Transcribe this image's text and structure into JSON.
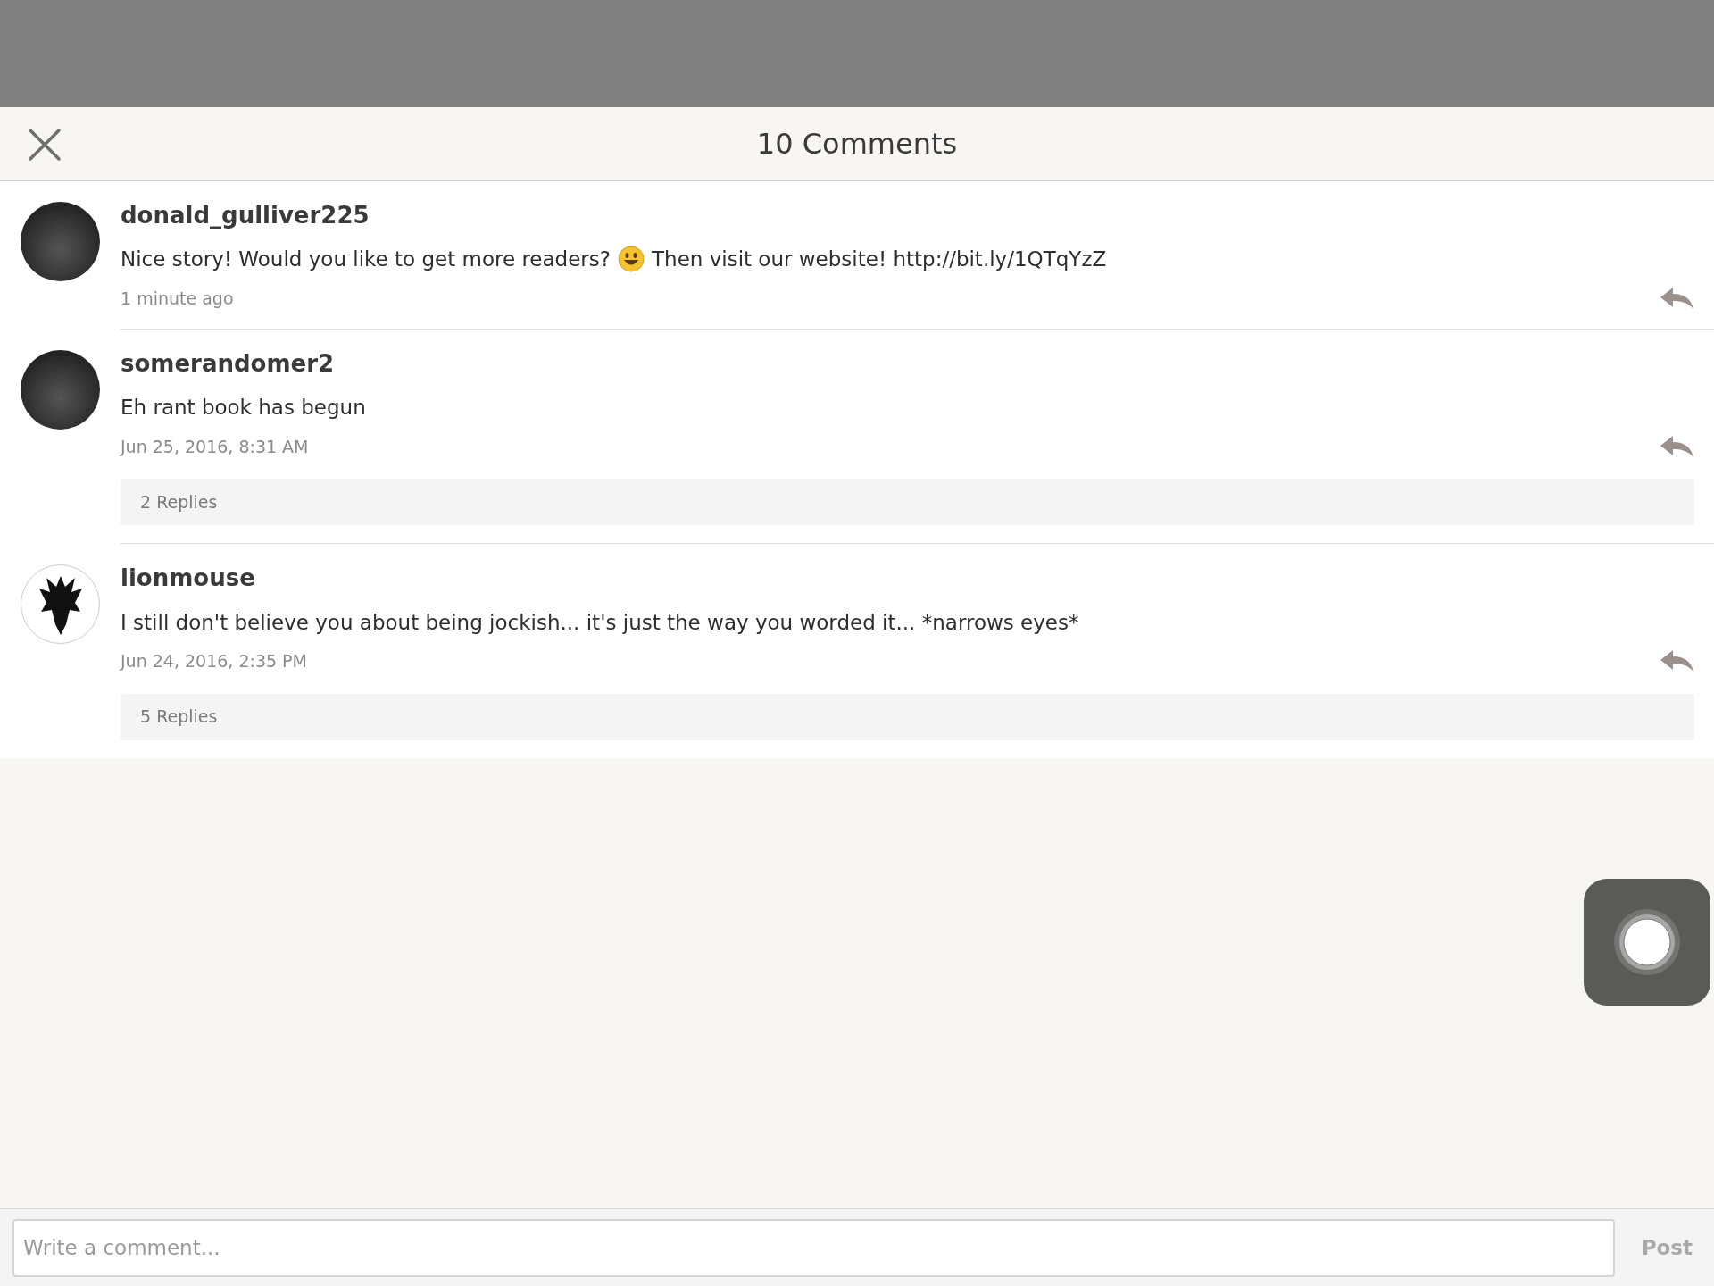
{
  "header": {
    "title": "10 Comments"
  },
  "comments": [
    {
      "username": "donald_gulliver225",
      "kind": "photo",
      "text_before": "Nice story! Would you like to get more readers?",
      "emoji": true,
      "text_after": "Then visit our website! http://bit.ly/1QTqYzZ",
      "time": "1 minute ago"
    },
    {
      "username": "somerandomer2",
      "kind": "photo",
      "text_before": "Eh rant book has begun",
      "time": "Jun 25, 2016, 8:31 AM",
      "replies": "2 Replies"
    },
    {
      "username": "lionmouse",
      "kind": "emblem",
      "text_before": "I still don't believe you about being jockish... it's just the way you worded it... *narrows eyes*",
      "time": "Jun 24, 2016, 2:35 PM",
      "replies": "5 Replies"
    }
  ],
  "composer": {
    "placeholder": "Write a comment...",
    "post": "Post",
    "post_disabled": true
  }
}
